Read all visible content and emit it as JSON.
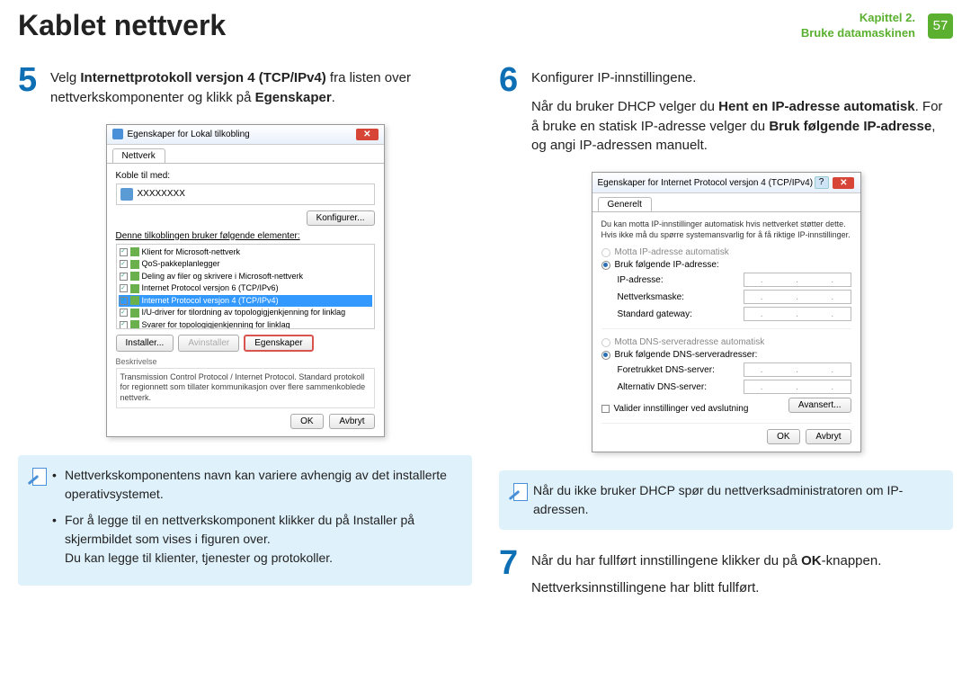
{
  "header": {
    "title": "Kablet nettverk",
    "chapter_line1": "Kapittel 2.",
    "chapter_line2": "Bruke datamaskinen",
    "page_number": "57"
  },
  "steps": {
    "s5": {
      "num": "5",
      "text_pre": "Velg ",
      "text_bold1": "Internettprotokoll versjon 4 (TCP/IPv4)",
      "text_mid": " fra listen over nettverkskomponenter og klikk på ",
      "text_bold2": "Egenskaper",
      "text_end": "."
    },
    "s6": {
      "num": "6",
      "line1": "Konfigurer IP-innstillingene.",
      "line2_pre": "Når du bruker DHCP velger du ",
      "line2_b1": "Hent en IP-adresse automatisk",
      "line2_mid": ". For å bruke en statisk IP-adresse velger du ",
      "line2_b2": "Bruk følgende IP-adresse",
      "line2_end": ", og angi IP-adressen manuelt."
    },
    "s7": {
      "num": "7",
      "line1_pre": "Når du har fullført innstillingene klikker du på ",
      "line1_b": "OK",
      "line1_end": "-knappen.",
      "line2": "Nettverksinnstillingene har blitt fullført."
    }
  },
  "dialog1": {
    "title": "Egenskaper for Lokal tilkobling",
    "tab": "Nettverk",
    "label_connect": "Koble til med:",
    "adapter": "XXXXXXXX",
    "btn_config": "Konfigurer...",
    "label_items": "Denne tilkoblingen bruker følgende elementer:",
    "items": [
      "Klient for Microsoft-nettverk",
      "QoS-pakkeplanlegger",
      "Deling av filer og skrivere i Microsoft-nettverk",
      "Internet Protocol versjon 6 (TCP/IPv6)",
      "Internet Protocol versjon 4 (TCP/IPv4)",
      "I/U-driver for tilordning av topologigjenkjenning for linklag",
      "Svarer for topologigjenkjenning for linklag"
    ],
    "btn_install": "Installer...",
    "btn_uninstall": "Avinstaller",
    "btn_props": "Egenskaper",
    "desc_label": "Beskrivelse",
    "desc_text": "Transmission Control Protocol / Internet Protocol. Standard protokoll for regionnett som tillater kommunikasjon over flere sammenkoblede nettverk.",
    "btn_ok": "OK",
    "btn_cancel": "Avbryt"
  },
  "dialog2": {
    "title": "Egenskaper for Internet Protocol versjon 4 (TCP/IPv4)",
    "tab": "Generelt",
    "intro": "Du kan motta IP-innstillinger automatisk hvis nettverket støtter dette. Hvis ikke må du spørre systemansvarlig for å få riktige IP-innstillinger.",
    "r1": "Motta IP-adresse automatisk",
    "r2": "Bruk følgende IP-adresse:",
    "f_ip": "IP-adresse:",
    "f_mask": "Nettverksmaske:",
    "f_gw": "Standard gateway:",
    "r3": "Motta DNS-serveradresse automatisk",
    "r4": "Bruk følgende DNS-serveradresser:",
    "f_dns1": "Foretrukket DNS-server:",
    "f_dns2": "Alternativ DNS-server:",
    "chk_validate": "Valider innstillinger ved avslutning",
    "btn_adv": "Avansert...",
    "btn_ok": "OK",
    "btn_cancel": "Avbryt"
  },
  "info_left": {
    "bullet1": "Nettverkskomponentens navn kan variere avhengig av det installerte operativsystemet.",
    "bullet2a": "For å legge til en nettverkskomponent klikker du på Installer på skjermbildet som vises i figuren over.",
    "bullet2b": "Du kan legge til klienter, tjenester og protokoller."
  },
  "info_right": {
    "text": "Når du ikke bruker DHCP spør du nettverksadministratoren om IP-adressen."
  }
}
